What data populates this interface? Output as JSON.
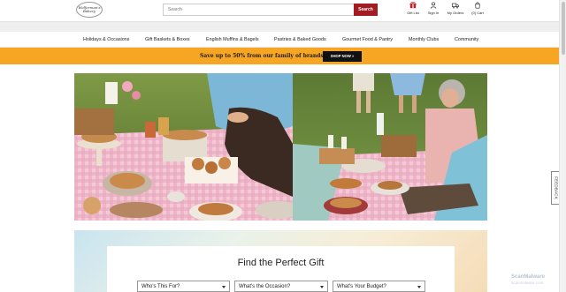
{
  "header": {
    "logo_text": "Wolferman's Bakery",
    "search_placeholder": "Search",
    "search_button": "Search",
    "icons": [
      {
        "label": "Gift List",
        "icon": "gift-icon"
      },
      {
        "label": "Sign In",
        "icon": "user-icon"
      },
      {
        "label": "My Orders",
        "icon": "truck-icon"
      },
      {
        "label": "(0) Cart",
        "icon": "cart-icon"
      }
    ]
  },
  "nav": {
    "items": [
      "Holidays & Occasions",
      "Gift Baskets & Boxes",
      "English Muffins & Bagels",
      "Pastries & Baked Goods",
      "Gourmet Food & Pantry",
      "Monthly Clubs",
      "Community"
    ]
  },
  "promo": {
    "text": "Save up to 50% from our family of brands.",
    "button": "SHOP NOW »"
  },
  "finder": {
    "title": "Find the Perfect Gift",
    "selects": [
      "Who's This For?",
      "What's the Occasion?",
      "What's Your Budget?"
    ]
  },
  "feedback": {
    "label": "FEEDBACK"
  },
  "watermark": {
    "title": "ScanMalware",
    "sub": "scanmalware.com"
  },
  "colors": {
    "brand_red": "#a31c24",
    "promo_orange": "#f6a623"
  }
}
